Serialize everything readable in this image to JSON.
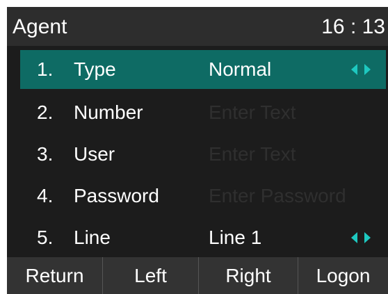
{
  "status": {
    "title": "Agent",
    "time": "16 : 13"
  },
  "rows": [
    {
      "num": "1.",
      "label": "Type",
      "value": "Normal",
      "placeholder": false,
      "arrows": true
    },
    {
      "num": "2.",
      "label": "Number",
      "value": "Enter Text",
      "placeholder": true,
      "arrows": false
    },
    {
      "num": "3.",
      "label": "User",
      "value": "Enter Text",
      "placeholder": true,
      "arrows": false
    },
    {
      "num": "4.",
      "label": "Password",
      "value": "Enter Password",
      "placeholder": true,
      "arrows": false
    },
    {
      "num": "5.",
      "label": "Line",
      "value": "Line 1",
      "placeholder": false,
      "arrows": true
    }
  ],
  "softkeys": [
    "Return",
    "Left",
    "Right",
    "Logon"
  ],
  "colors": {
    "selected_row": "#0e6b64",
    "arrow_accent": "#1ec8c0",
    "background": "#1c1c1c",
    "bars": "#333333"
  },
  "icons": {
    "selector_arrows": "left-right-arrows-icon"
  }
}
